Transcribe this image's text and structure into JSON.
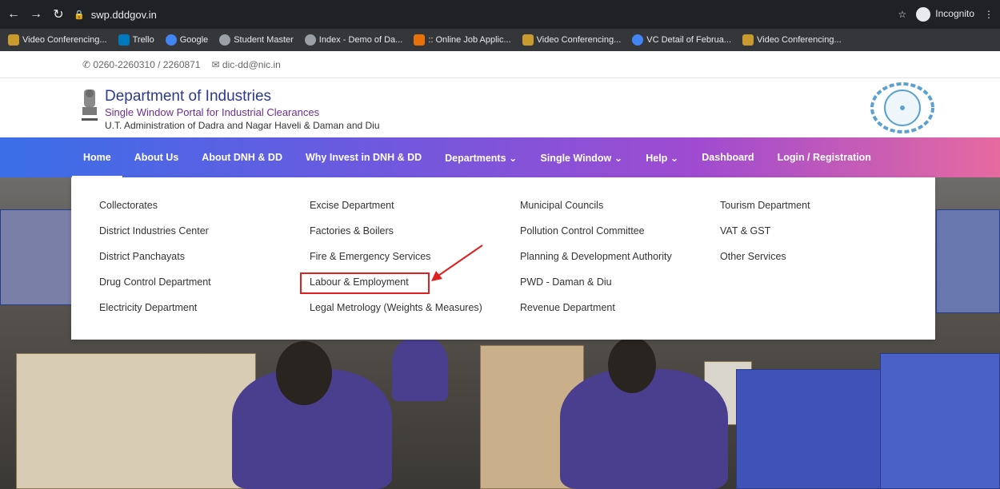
{
  "browser": {
    "url": "swp.dddgov.in",
    "incognito_label": "Incognito",
    "bookmarks": [
      {
        "label": "Video Conferencing...",
        "color": "#c99a2e"
      },
      {
        "label": "Trello",
        "color": "#0079bf"
      },
      {
        "label": "Google",
        "color": "#4285f4"
      },
      {
        "label": "Student Master",
        "color": "#9aa0a6"
      },
      {
        "label": "Index - Demo of Da...",
        "color": "#9aa0a6"
      },
      {
        "label": ":: Online Job Applic...",
        "color": "#e8710a"
      },
      {
        "label": "Video Conferencing...",
        "color": "#c99a2e"
      },
      {
        "label": "VC Detail of Februa...",
        "color": "#4285f4"
      },
      {
        "label": "Video Conferencing...",
        "color": "#c99a2e"
      }
    ]
  },
  "contact": {
    "phone": "0260-2260310 / 2260871",
    "email": "dic-dd@nic.in"
  },
  "header": {
    "title": "Department of Industries",
    "subtitle": "Single Window Portal for Industrial Clearances",
    "administration": "U.T. Administration of Dadra and Nagar Haveli & Daman and Diu"
  },
  "nav": {
    "items": [
      {
        "label": "Home"
      },
      {
        "label": "About Us"
      },
      {
        "label": "About DNH & DD"
      },
      {
        "label": "Why Invest in DNH & DD"
      },
      {
        "label": "Departments ⌄"
      },
      {
        "label": "Single Window ⌄"
      },
      {
        "label": "Help ⌄"
      },
      {
        "label": "Dashboard"
      },
      {
        "label": "Login / Registration"
      }
    ]
  },
  "dropdown": {
    "col1": [
      "Collectorates",
      "District Industries Center",
      "District Panchayats",
      "Drug Control Department",
      "Electricity Department"
    ],
    "col2": [
      "Excise Department",
      "Factories & Boilers",
      "Fire & Emergency Services",
      "Labour & Employment",
      "Legal Metrology (Weights & Measures)"
    ],
    "col3": [
      "Municipal Councils",
      "Pollution Control Committee",
      "Planning & Development Authority",
      "PWD - Daman & Diu",
      "Revenue Department"
    ],
    "col4": [
      "Tourism Department",
      "VAT & GST",
      "Other Services"
    ]
  },
  "colors": {
    "nav_gradient_start": "#3a6fe8",
    "nav_gradient_end": "#e66aa0",
    "highlight": "#e02020",
    "title": "#2c3a8c"
  }
}
